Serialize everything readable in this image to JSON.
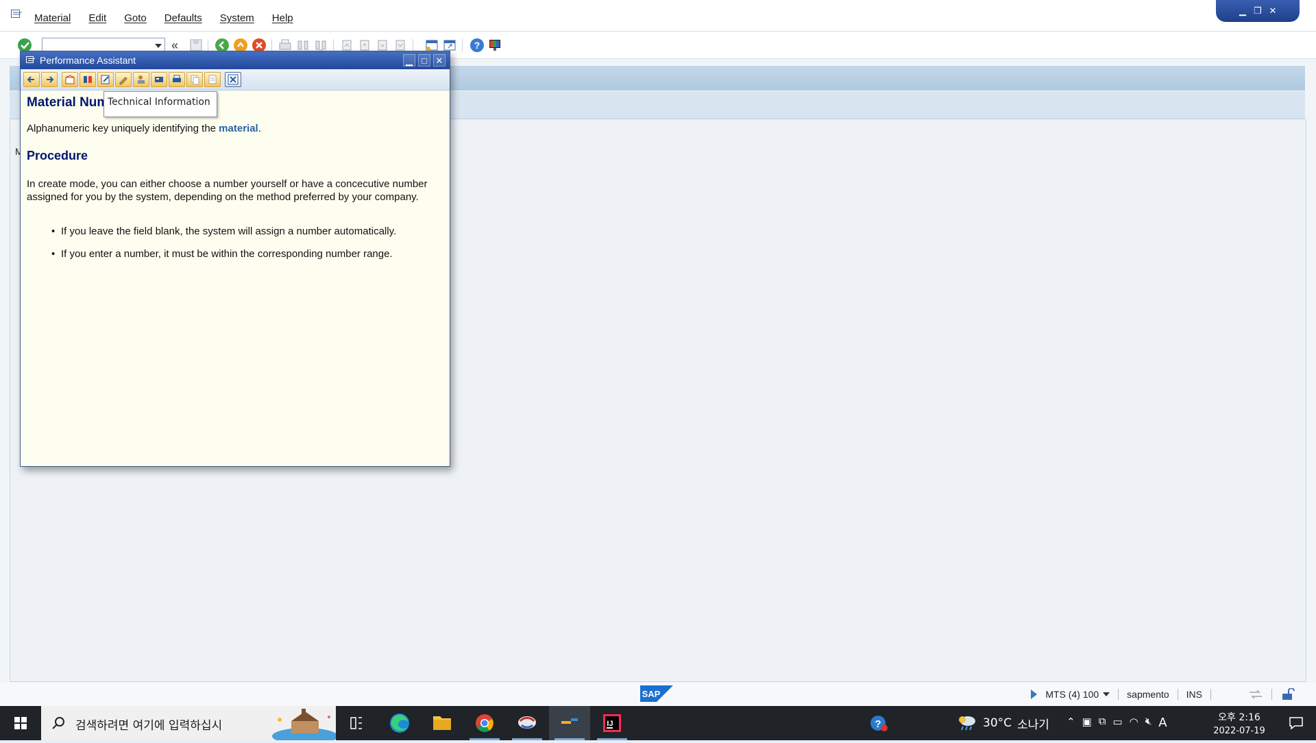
{
  "menu": {
    "items": [
      "Material",
      "Edit",
      "Goto",
      "Defaults",
      "System",
      "Help"
    ]
  },
  "toolbar": {
    "command_value": ""
  },
  "hidden_label": "M",
  "performance_assistant": {
    "title": "Performance Assistant",
    "heading": "Material Num",
    "tooltip": "Technical Information",
    "definition_prefix": "Alphanumeric key uniquely identifying the ",
    "definition_link": "material",
    "definition_suffix": ".",
    "procedure_heading": "Procedure",
    "procedure_text": "In create mode, you can either choose a number yourself or have a concecutive number assigned for you by the system, depending on the method preferred by your company.",
    "bullets": [
      "If you leave the field blank, the system will assign a number automatically.",
      "If you enter a number, it must be within the corresponding number range."
    ]
  },
  "statusbar": {
    "system": "MTS (4) 100",
    "user": "sapmento",
    "mode": "INS"
  },
  "taskbar": {
    "search_placeholder": "검색하려면 여기에 입력하십시",
    "weather_temp": "30°C",
    "weather_desc": "소나기",
    "time": "오후 2:16",
    "date": "2022-07-19",
    "ime": "A"
  },
  "colors": {
    "sap_blue": "#23489a",
    "heading_navy": "#00166e",
    "link_blue": "#2a5fa8",
    "help_bg": "#fefef0"
  }
}
